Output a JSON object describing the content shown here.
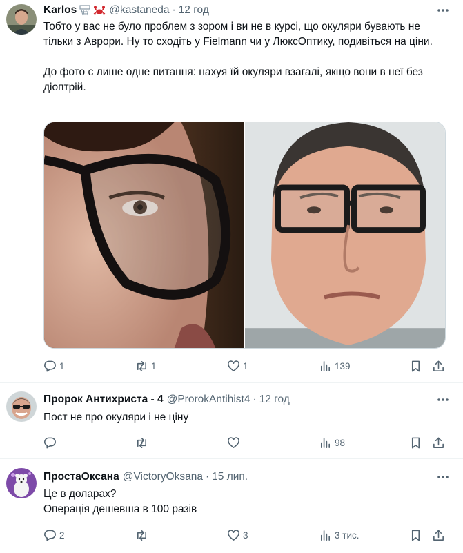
{
  "tweets": [
    {
      "name": "Karlos",
      "handle": "@kastaneda",
      "dot": "·",
      "time": "12 год",
      "text": [
        "Тобто у вас не було проблем з зором і ви не в курсі, що окуляри бувають не тільки з Аврори. Ну то сходіть у Fielmann чи у ЛюксОптику, подивіться на ціни.",
        "",
        "До фото є лише одне питання: нахуя їй окуляри взагалі, якщо вони в неї без діоптрій."
      ],
      "stats": {
        "replies": "1",
        "reposts": "1",
        "likes": "1",
        "views": "139"
      },
      "name_emojis": [
        "basketball-hoop-icon",
        "crab-icon"
      ]
    },
    {
      "name": "Пророк Антихриста - 4",
      "handle": "@ProrokAntihist4",
      "dot": "·",
      "time": "12 год",
      "text": [
        "Пост не про окуляри і не ціну"
      ],
      "stats": {
        "replies": "",
        "reposts": "",
        "likes": "",
        "views": "98"
      }
    },
    {
      "name": "ПростаОксана",
      "handle": "@VictoryOksana",
      "dot": "·",
      "time": "15 лип.",
      "text": [
        "Це в доларах?",
        "Операція дешевша в 100 разів"
      ],
      "stats": {
        "replies": "2",
        "reposts": "",
        "likes": "3",
        "views": "3 тис."
      }
    }
  ],
  "colors": {
    "text": "#0f1419",
    "secondary": "#536471",
    "divider": "#eff3f4",
    "crab": "#d2282e"
  }
}
